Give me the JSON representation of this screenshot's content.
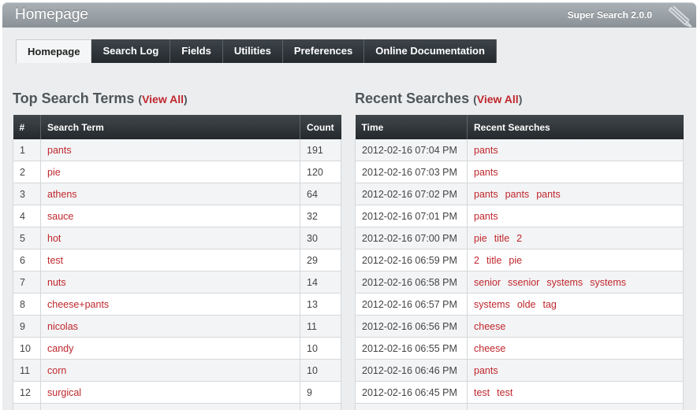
{
  "header": {
    "title": "Homepage",
    "version": "Super Search 2.0.0"
  },
  "tabs": [
    {
      "label": "Homepage",
      "active": true
    },
    {
      "label": "Search Log",
      "active": false
    },
    {
      "label": "Fields",
      "active": false
    },
    {
      "label": "Utilities",
      "active": false
    },
    {
      "label": "Preferences",
      "active": false
    },
    {
      "label": "Online Documentation",
      "active": false
    }
  ],
  "top_terms": {
    "title": "Top Search Terms",
    "view_all": "View All",
    "columns": [
      "#",
      "Search Term",
      "Count"
    ],
    "rows": [
      {
        "num": "1",
        "term": "pants",
        "count": "191"
      },
      {
        "num": "2",
        "term": "pie",
        "count": "120"
      },
      {
        "num": "3",
        "term": "athens",
        "count": "64"
      },
      {
        "num": "4",
        "term": "sauce",
        "count": "32"
      },
      {
        "num": "5",
        "term": "hot",
        "count": "30"
      },
      {
        "num": "6",
        "term": "test",
        "count": "29"
      },
      {
        "num": "7",
        "term": "nuts",
        "count": "14"
      },
      {
        "num": "8",
        "term": "cheese+pants",
        "count": "13"
      },
      {
        "num": "9",
        "term": "nicolas",
        "count": "11"
      },
      {
        "num": "10",
        "term": "candy",
        "count": "10"
      },
      {
        "num": "11",
        "term": "corn",
        "count": "10"
      },
      {
        "num": "12",
        "term": "surgical",
        "count": "9"
      },
      {
        "num": "",
        "term": "",
        "count": ""
      }
    ]
  },
  "recent": {
    "title": "Recent Searches",
    "view_all": "View All",
    "columns": [
      "Time",
      "Recent Searches"
    ],
    "rows": [
      {
        "time": "2012-02-16 07:04 PM",
        "terms": [
          "pants"
        ]
      },
      {
        "time": "2012-02-16 07:03 PM",
        "terms": [
          "pants"
        ]
      },
      {
        "time": "2012-02-16 07:02 PM",
        "terms": [
          "pants",
          "pants",
          "pants"
        ]
      },
      {
        "time": "2012-02-16 07:01 PM",
        "terms": [
          "pants"
        ]
      },
      {
        "time": "2012-02-16 07:00 PM",
        "terms": [
          "pie",
          "title",
          "2"
        ]
      },
      {
        "time": "2012-02-16 06:59 PM",
        "terms": [
          "2",
          "title",
          "pie"
        ]
      },
      {
        "time": "2012-02-16 06:58 PM",
        "terms": [
          "senior",
          "ssenior",
          "systems",
          "systems"
        ]
      },
      {
        "time": "2012-02-16 06:57 PM",
        "terms": [
          "systems",
          "olde",
          "tag"
        ]
      },
      {
        "time": "2012-02-16 06:56 PM",
        "terms": [
          "cheese"
        ]
      },
      {
        "time": "2012-02-16 06:55 PM",
        "terms": [
          "cheese"
        ]
      },
      {
        "time": "2012-02-16 06:46 PM",
        "terms": [
          "pants"
        ]
      },
      {
        "time": "2012-02-16 06:45 PM",
        "terms": [
          "test",
          "test"
        ]
      },
      {
        "time": "",
        "terms": []
      }
    ]
  },
  "colors": {
    "accent": "#c0272d",
    "tab_bg": "#2e3438",
    "header_bg": "#9aa2a7"
  },
  "icons": {
    "logo": "pencil-logo-icon"
  }
}
